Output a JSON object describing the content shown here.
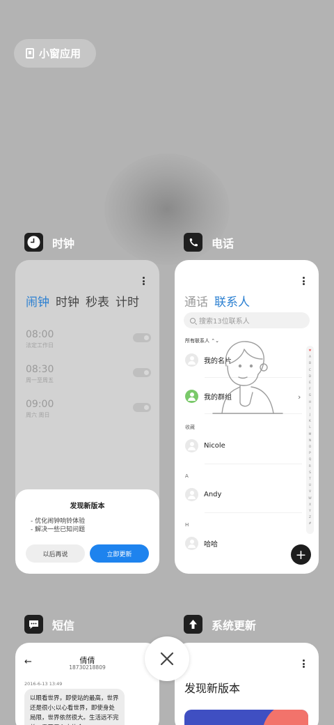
{
  "small_window": {
    "label": "小窗应用",
    "icon": "small-window-icon"
  },
  "apps": {
    "clock": {
      "name": "时钟",
      "icon": "clock-icon",
      "tabs": [
        "闹钟",
        "时钟",
        "秒表",
        "计时"
      ],
      "active_tab": "闹钟",
      "alarms": [
        {
          "time": "08:00",
          "label": "法定工作日"
        },
        {
          "time": "08:30",
          "label": "周一至周五"
        },
        {
          "time": "09:00",
          "label": "周六 周日"
        }
      ],
      "update_dialog": {
        "title": "发现新版本",
        "lines": [
          "- 优化闹钟响铃体验",
          "- 解决一些已知问题"
        ],
        "later_label": "以后再说",
        "now_label": "立即更新"
      }
    },
    "phone": {
      "name": "电话",
      "icon": "phone-icon",
      "tabs": [
        "通话",
        "联系人"
      ],
      "active_tab": "联系人",
      "search_placeholder": "搜索13位联系人",
      "filter_label": "所有联系人 ⌃⌄",
      "my_card": "我的名片",
      "my_groups": "我的群组",
      "sections": [
        {
          "header": "收藏",
          "name": "Nicole"
        },
        {
          "header": "A",
          "name": "Andy"
        },
        {
          "header": "H",
          "name": "哈哈"
        }
      ],
      "alphabet": [
        "♥",
        "A",
        "B",
        "C",
        "D",
        "E",
        "F",
        "G",
        "H",
        "I",
        "J",
        "K",
        "L",
        "M",
        "N",
        "O",
        "P",
        "Q",
        "R",
        "S",
        "T",
        "U",
        "V",
        "W",
        "X",
        "Y",
        "Z",
        "#"
      ],
      "fab_label": "+"
    },
    "sms": {
      "name": "短信",
      "icon": "message-icon",
      "back": "←",
      "contact_name": "倩倩",
      "contact_number": "18730218809",
      "date": "2016-6-13 13:49",
      "message": "以眼看世界，即使站的最高，世界还是很小;以心看世界，即使身处局限，世界依然很大。生活远不完美，需要用心去体会。"
    },
    "updater": {
      "name": "系统更新",
      "icon": "update-arrow-icon",
      "title": "发现新版本"
    }
  },
  "close_label": "×"
}
